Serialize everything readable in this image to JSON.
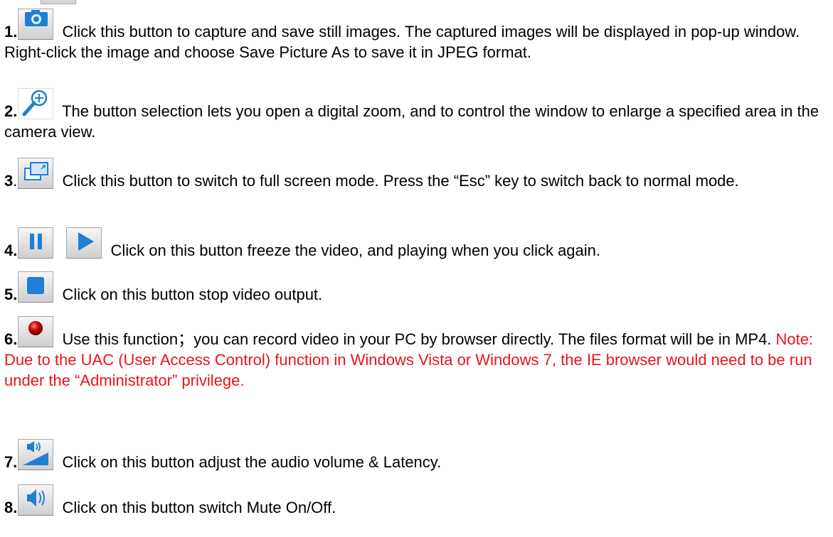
{
  "items": [
    {
      "num": "1.",
      "text": "Click this button to capture and save still images. The captured images will be displayed in pop-up window. Right-click the image and choose Save Picture As to save it in JPEG format.",
      "icon": "camera-icon"
    },
    {
      "num": "2.",
      "text": "The button selection lets you open a digital zoom, and to control the window to enlarge a specified area in the camera view.",
      "icon": "zoom-in-icon"
    },
    {
      "num": "3",
      "text": "Click this button to switch to full screen mode. Press the “Esc” key to switch back to normal mode.",
      "icon": "fullscreen-icon",
      "num_dot": "."
    },
    {
      "num": "4.",
      "text": "Click on this button freeze the video, and playing when you click again.",
      "icon": "pause-icon",
      "icon2": "play-icon"
    },
    {
      "num": "5.",
      "text": "Click on this button stop video output.",
      "icon": "stop-icon"
    },
    {
      "num": "6.",
      "text": "Use this function；you can record video in your PC by browser directly. The files format will be in MP4.",
      "note": "Note: Due to the UAC (User Access Control) function in Windows Vista or Windows 7, the IE browser would need to be run under the “Administrator” privilege.",
      "icon": "record-icon"
    },
    {
      "num": "7.",
      "text": "Click on this button adjust the audio volume & Latency.",
      "icon": "volume-adjust-icon"
    },
    {
      "num": "8.",
      "text": "Click on this button switch Mute On/Off.",
      "icon": "speaker-icon"
    }
  ],
  "colors": {
    "note": "#e8141c",
    "icon_blue": "#1e7fd4"
  }
}
